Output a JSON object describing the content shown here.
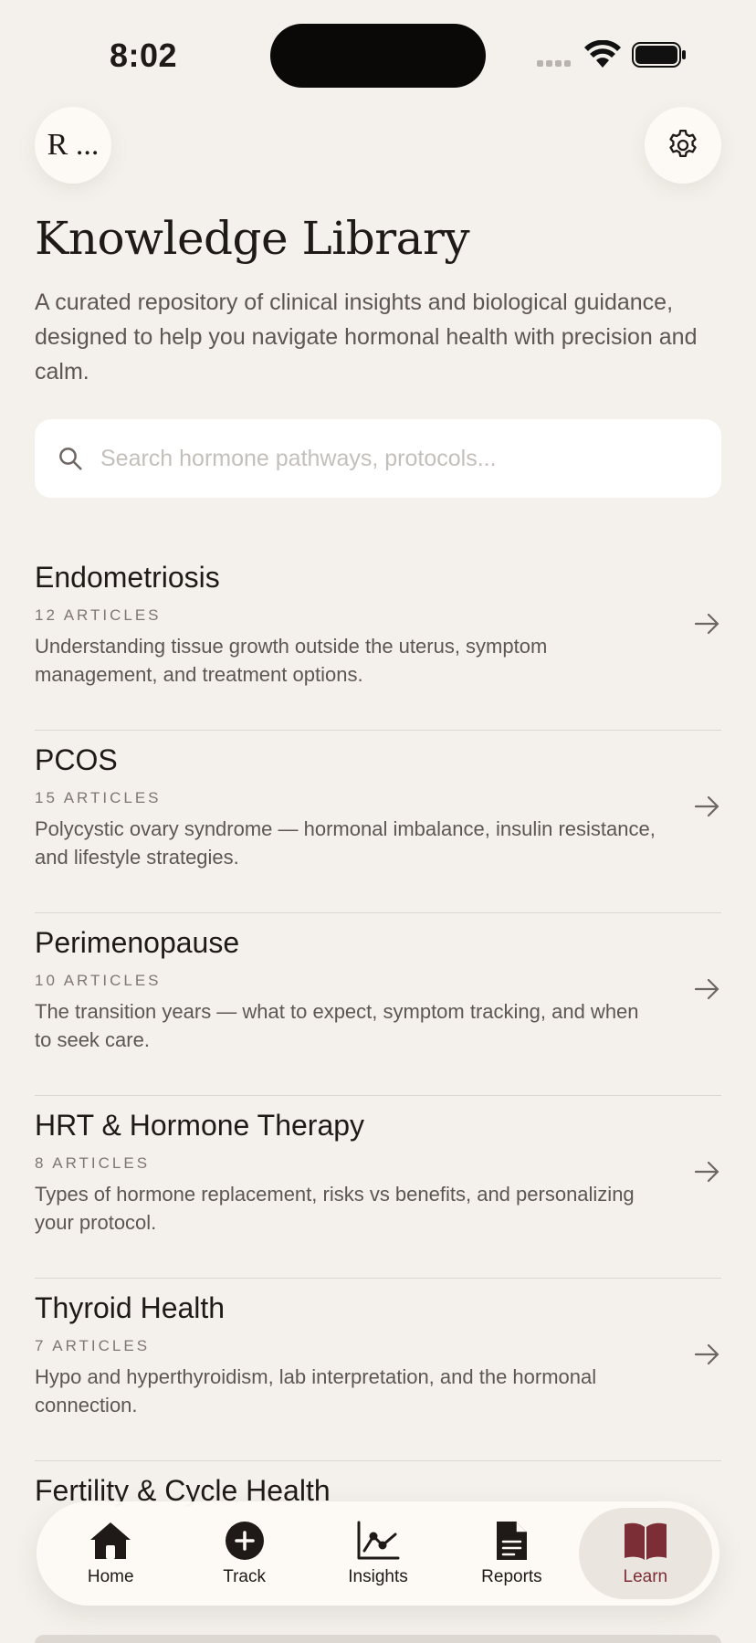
{
  "status_bar": {
    "time": "8:02"
  },
  "header": {
    "avatar_initials": "R ..."
  },
  "page": {
    "title": "Knowledge Library",
    "intro": "A curated repository of clinical insights and biological guidance, designed to help you navigate hormonal health with precision and calm."
  },
  "search": {
    "placeholder": "Search hormone pathways, protocols...",
    "value": ""
  },
  "topics": [
    {
      "title": "Endometriosis",
      "count": "12 ARTICLES",
      "description": "Understanding tissue growth outside the uterus, symptom management, and treatment options."
    },
    {
      "title": "PCOS",
      "count": "15 ARTICLES",
      "description": "Polycystic ovary syndrome — hormonal imbalance, insulin resistance, and lifestyle strategies."
    },
    {
      "title": "Perimenopause",
      "count": "10 ARTICLES",
      "description": "The transition years — what to expect, symptom tracking, and when to seek care."
    },
    {
      "title": "HRT & Hormone Therapy",
      "count": "8 ARTICLES",
      "description": "Types of hormone replacement, risks vs benefits, and personalizing your protocol."
    },
    {
      "title": "Thyroid Health",
      "count": "7 ARTICLES",
      "description": "Hypo and hyperthyroidism, lab interpretation, and the hormonal connection."
    },
    {
      "title": "Fertility & Cycle Health",
      "count": "",
      "description": ""
    }
  ],
  "tabs": [
    {
      "label": "Home",
      "icon": "home-icon"
    },
    {
      "label": "Track",
      "icon": "plus-circle-icon"
    },
    {
      "label": "Insights",
      "icon": "chart-icon"
    },
    {
      "label": "Reports",
      "icon": "document-icon"
    },
    {
      "label": "Learn",
      "icon": "book-icon"
    }
  ],
  "colors": {
    "background": "#f4f1ec",
    "accent": "#7b2e36",
    "text": "#1f1a17"
  }
}
